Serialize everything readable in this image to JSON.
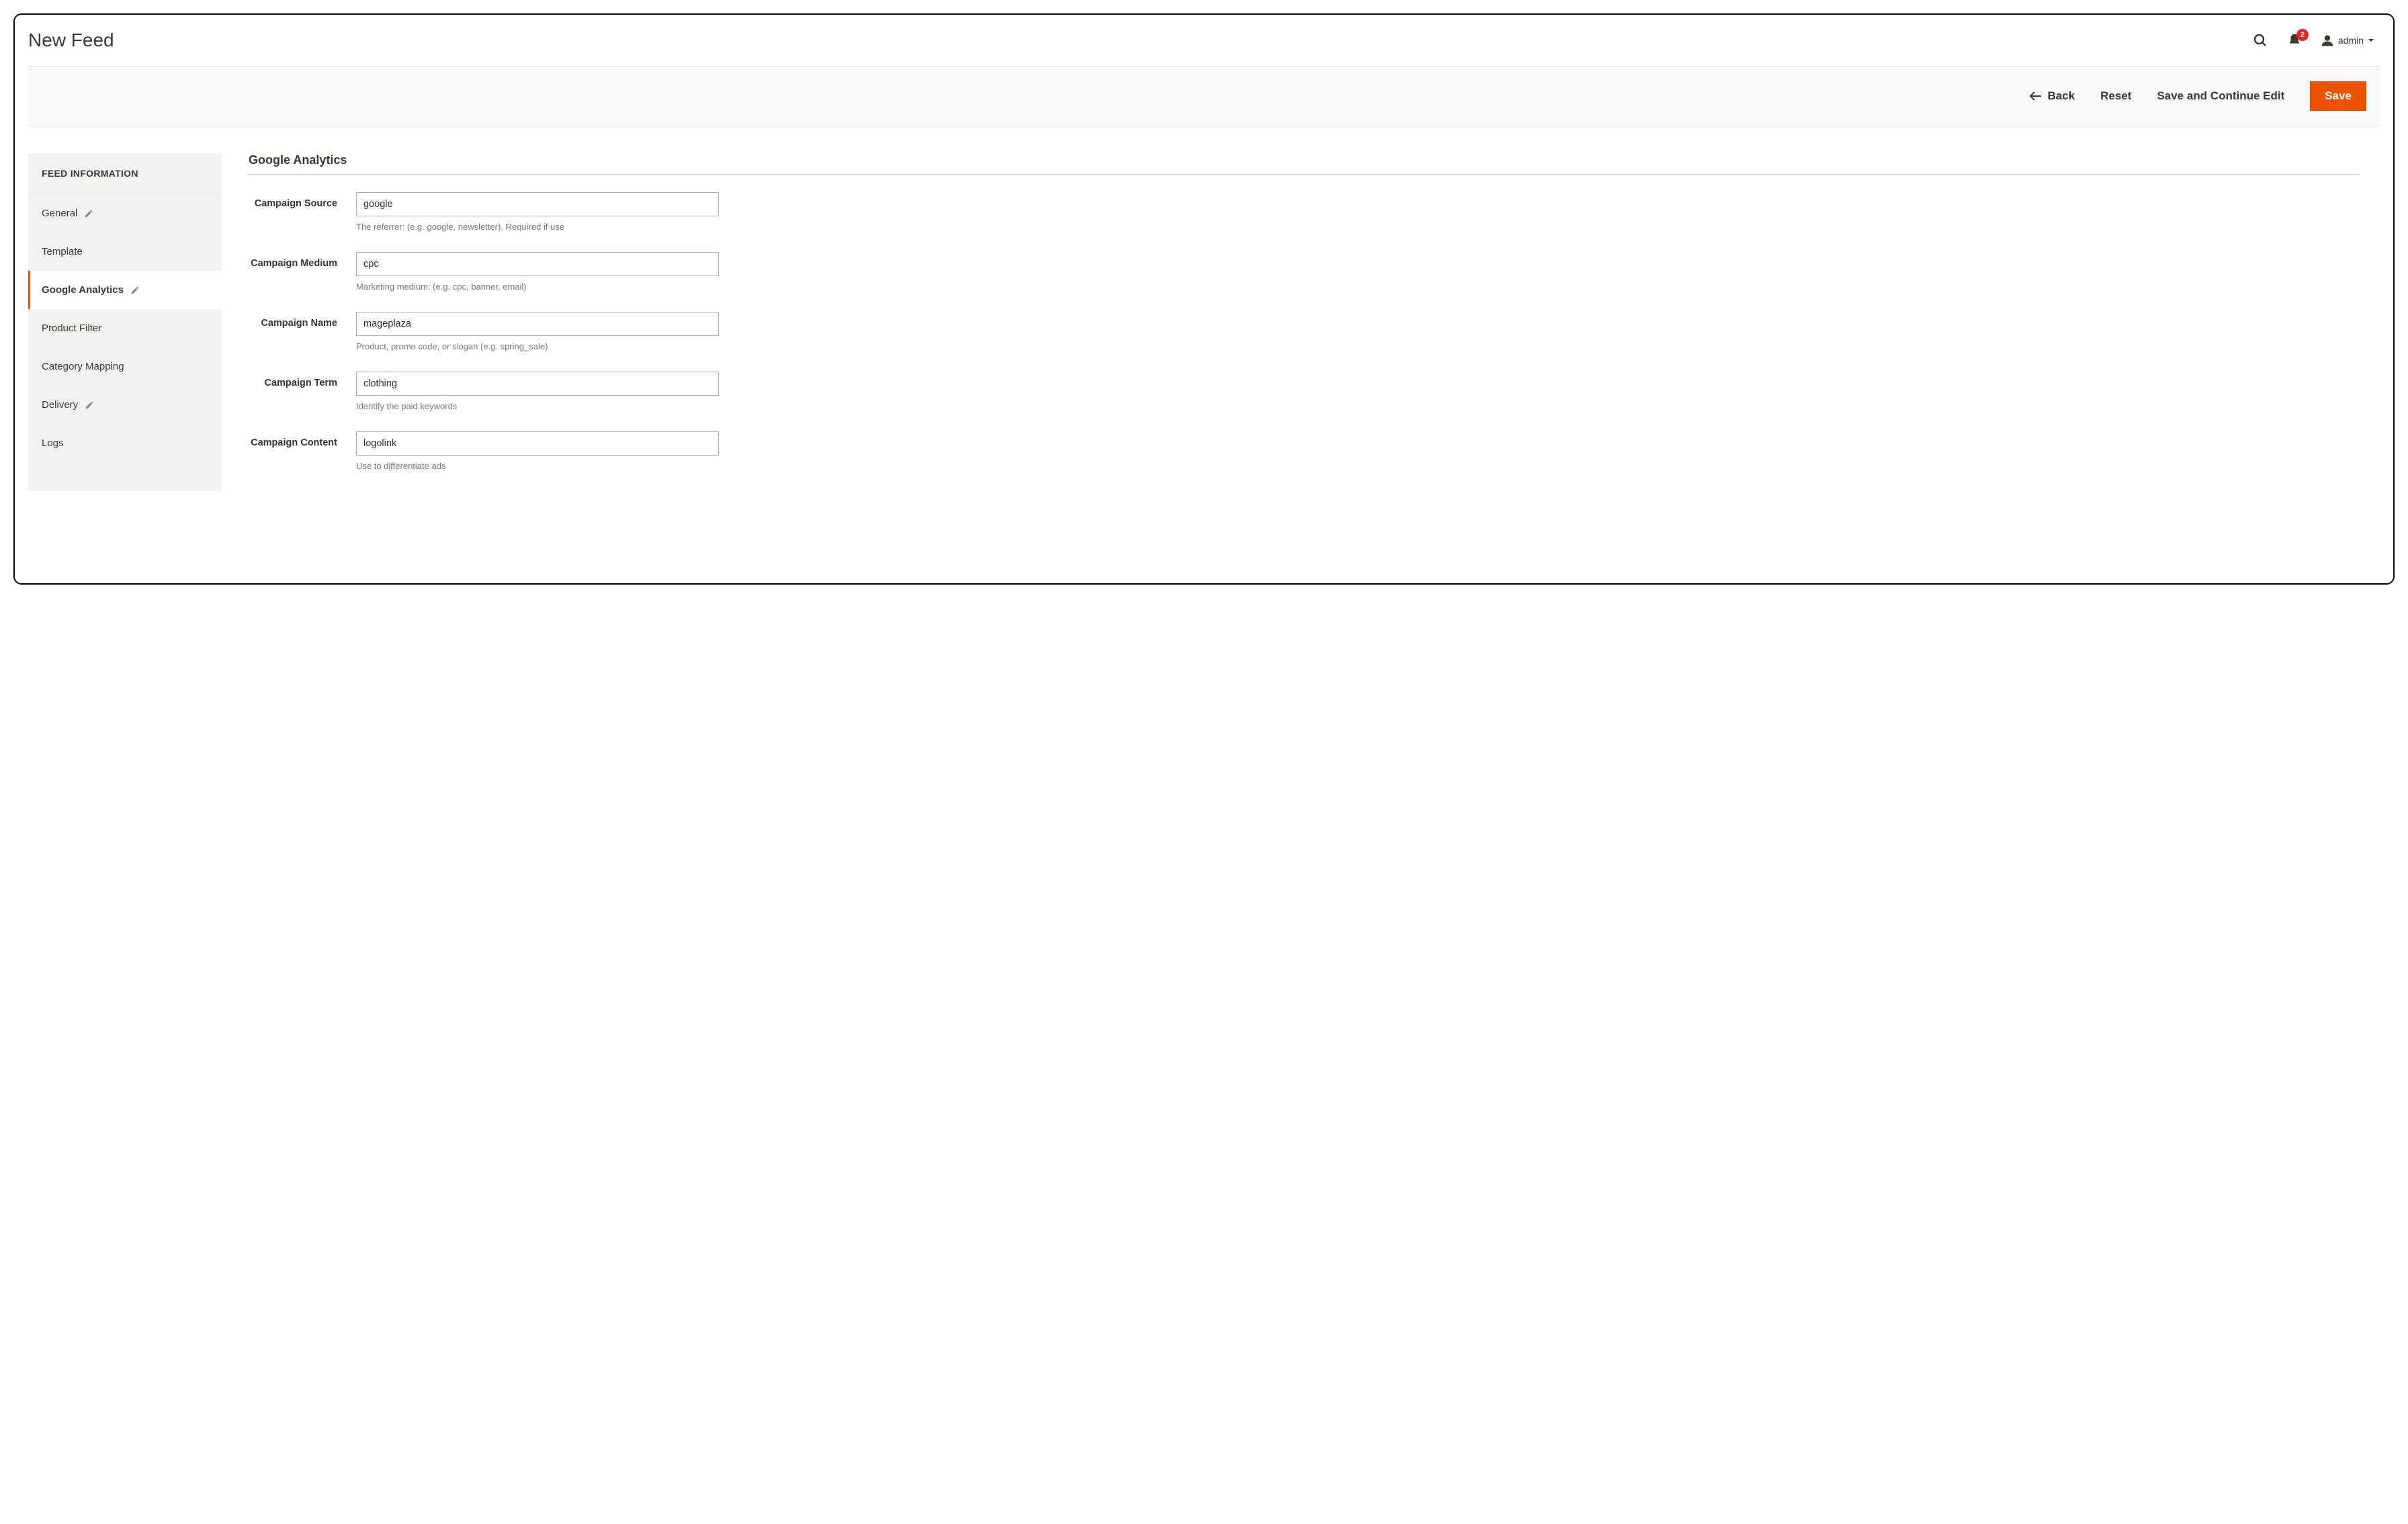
{
  "header": {
    "title": "New Feed",
    "notification_count": "2",
    "admin_label": "admin"
  },
  "actions": {
    "back": "Back",
    "reset": "Reset",
    "save_continue": "Save and Continue Edit",
    "save": "Save"
  },
  "sidebar": {
    "header": "FEED INFORMATION",
    "items": [
      {
        "label": "General",
        "edit": true
      },
      {
        "label": "Template",
        "edit": false
      },
      {
        "label": "Google Analytics",
        "edit": true
      },
      {
        "label": "Product Filter",
        "edit": false
      },
      {
        "label": "Category Mapping",
        "edit": false
      },
      {
        "label": "Delivery",
        "edit": true
      },
      {
        "label": "Logs",
        "edit": false
      }
    ]
  },
  "section": {
    "title": "Google Analytics",
    "fields": {
      "source": {
        "label": "Campaign Source",
        "value": "google",
        "hint": "The referrer: (e.g. google, newsletter). Required if use"
      },
      "medium": {
        "label": "Campaign Medium",
        "value": "cpc",
        "hint": "Marketing medium: (e.g. cpc, banner, email)"
      },
      "name": {
        "label": "Campaign Name",
        "value": "mageplaza",
        "hint": "Product, promo code, or slogan (e.g. spring_sale)"
      },
      "term": {
        "label": "Campaign Term",
        "value": "clothing",
        "hint": "Identify the paid keywords"
      },
      "content": {
        "label": "Campaign Content",
        "value": "logolink",
        "hint": "Use to differentiate ads"
      }
    }
  }
}
